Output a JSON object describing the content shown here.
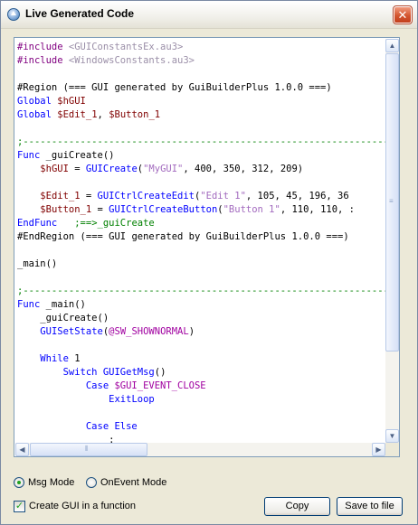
{
  "window": {
    "title": "Live Generated Code"
  },
  "icons": {
    "app": "app-arrow-icon",
    "close": "close-icon"
  },
  "code_lines": [
    [
      {
        "c": "dir",
        "t": "#include "
      },
      {
        "c": "inc",
        "t": "<GUIConstantsEx.au3>"
      }
    ],
    [
      {
        "c": "dir",
        "t": "#include "
      },
      {
        "c": "inc",
        "t": "<WindowsConstants.au3>"
      }
    ],
    [],
    [
      {
        "c": "pl",
        "t": "#Region "
      },
      {
        "c": "pl",
        "t": "(=== GUI generated by GuiBuilderPlus 1.0.0 ===)"
      }
    ],
    [
      {
        "c": "kw",
        "t": "Global "
      },
      {
        "c": "var",
        "t": "$hGUI"
      }
    ],
    [
      {
        "c": "kw",
        "t": "Global "
      },
      {
        "c": "var",
        "t": "$Edit_1"
      },
      {
        "c": "pl",
        "t": ", "
      },
      {
        "c": "var",
        "t": "$Button_1"
      }
    ],
    [],
    [
      {
        "c": "cm",
        "t": ";------------------------------------------------------------------------------"
      }
    ],
    [
      {
        "c": "kw",
        "t": "Func "
      },
      {
        "c": "pl",
        "t": "_guiCreate()"
      }
    ],
    [
      {
        "c": "pl",
        "t": "    "
      },
      {
        "c": "var",
        "t": "$hGUI"
      },
      {
        "c": "pl",
        "t": " = "
      },
      {
        "c": "fn",
        "t": "GUICreate"
      },
      {
        "c": "pl",
        "t": "("
      },
      {
        "c": "str",
        "t": "\"MyGUI\""
      },
      {
        "c": "pl",
        "t": ", 400, 350, 312, 209)"
      }
    ],
    [],
    [
      {
        "c": "pl",
        "t": "    "
      },
      {
        "c": "var",
        "t": "$Edit_1"
      },
      {
        "c": "pl",
        "t": " = "
      },
      {
        "c": "fn",
        "t": "GUICtrlCreateEdit"
      },
      {
        "c": "pl",
        "t": "("
      },
      {
        "c": "str",
        "t": "\"Edit 1\""
      },
      {
        "c": "pl",
        "t": ", 105, 45, 196, 36"
      }
    ],
    [
      {
        "c": "pl",
        "t": "    "
      },
      {
        "c": "var",
        "t": "$Button_1"
      },
      {
        "c": "pl",
        "t": " = "
      },
      {
        "c": "fn",
        "t": "GUICtrlCreateButton"
      },
      {
        "c": "pl",
        "t": "("
      },
      {
        "c": "str",
        "t": "\"Button 1\""
      },
      {
        "c": "pl",
        "t": ", 110, 110, :"
      }
    ],
    [
      {
        "c": "kw",
        "t": "EndFunc"
      },
      {
        "c": "pl",
        "t": "   "
      },
      {
        "c": "cm",
        "t": ";==>_guiCreate"
      }
    ],
    [
      {
        "c": "pl",
        "t": "#EndRegion "
      },
      {
        "c": "pl",
        "t": "(=== GUI generated by GuiBuilderPlus 1.0.0 ===)"
      }
    ],
    [],
    [
      {
        "c": "pl",
        "t": "_main()"
      }
    ],
    [],
    [
      {
        "c": "cm",
        "t": ";------------------------------------------------------------------------------"
      }
    ],
    [
      {
        "c": "kw",
        "t": "Func "
      },
      {
        "c": "pl",
        "t": "_main()"
      }
    ],
    [
      {
        "c": "pl",
        "t": "    _guiCreate()"
      }
    ],
    [
      {
        "c": "pl",
        "t": "    "
      },
      {
        "c": "fn",
        "t": "GUISetState"
      },
      {
        "c": "pl",
        "t": "("
      },
      {
        "c": "mac",
        "t": "@SW_SHOWNORMAL"
      },
      {
        "c": "pl",
        "t": ")"
      }
    ],
    [],
    [
      {
        "c": "pl",
        "t": "    "
      },
      {
        "c": "kw",
        "t": "While "
      },
      {
        "c": "pl",
        "t": "1"
      }
    ],
    [
      {
        "c": "pl",
        "t": "        "
      },
      {
        "c": "kw",
        "t": "Switch "
      },
      {
        "c": "fn",
        "t": "GUIGetMsg"
      },
      {
        "c": "pl",
        "t": "()"
      }
    ],
    [
      {
        "c": "pl",
        "t": "            "
      },
      {
        "c": "kw",
        "t": "Case "
      },
      {
        "c": "mac",
        "t": "$GUI_EVENT_CLOSE"
      }
    ],
    [
      {
        "c": "pl",
        "t": "                "
      },
      {
        "c": "kw",
        "t": "ExitLoop"
      }
    ],
    [],
    [
      {
        "c": "pl",
        "t": "            "
      },
      {
        "c": "kw",
        "t": "Case Else"
      }
    ],
    [
      {
        "c": "pl",
        "t": "                :"
      }
    ]
  ],
  "scrollbars": {
    "up_icon": "scroll-up-arrow-icon",
    "down_icon": "scroll-down-arrow-icon",
    "left_icon": "scroll-left-arrow-icon",
    "right_icon": "scroll-right-arrow-icon"
  },
  "options": {
    "msg_mode": "Msg Mode",
    "onevent_mode": "OnEvent Mode",
    "create_gui_function": "Create GUI in a function"
  },
  "buttons": {
    "copy": "Copy",
    "save": "Save to file"
  }
}
